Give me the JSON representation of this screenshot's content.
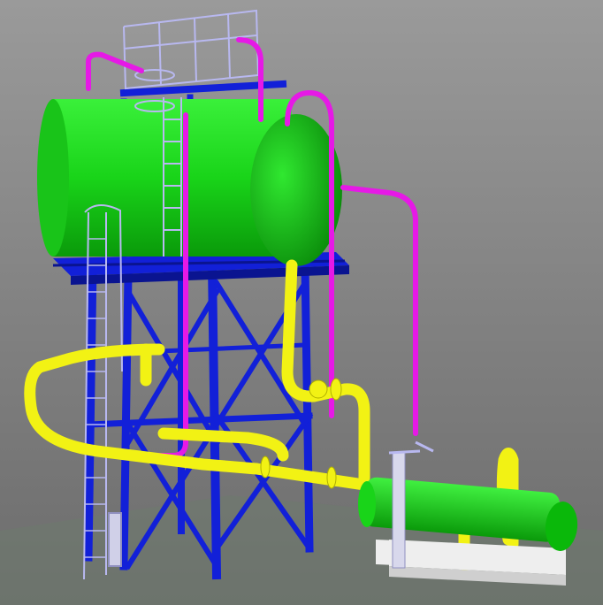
{
  "scene": {
    "subject": "",
    "colors": {
      "background_top": "#9a9a9a",
      "background_bottom": "#6c6c6c",
      "floor": "#6e7a6e",
      "vessel_green": "#19d419",
      "vessel_green_dark": "#0a8a0a",
      "steel_blue": "#1220d8",
      "steel_blue_dark": "#0a1490",
      "handrail": "#b8b8f0",
      "pipe_yellow": "#f2f214",
      "pipe_yellow_dark": "#b0b000",
      "pipe_magenta": "#e619e6",
      "concrete": "#eeeeee"
    }
  }
}
